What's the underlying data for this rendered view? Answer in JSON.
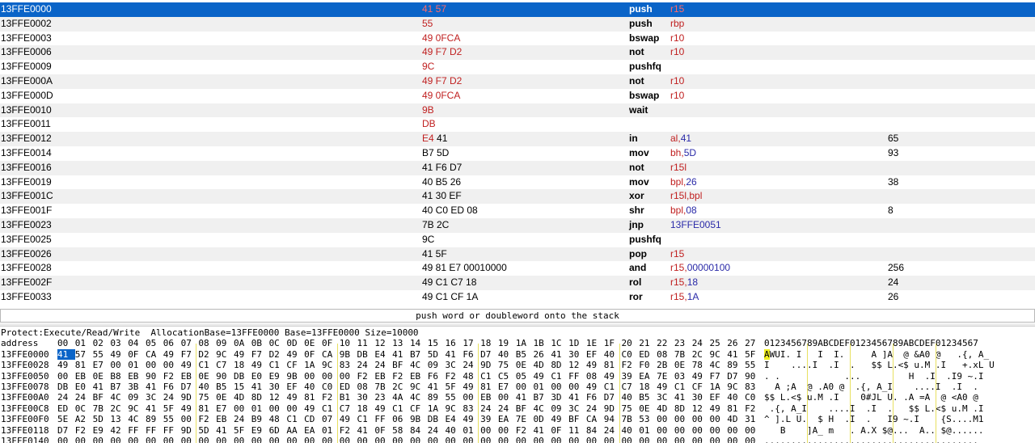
{
  "disasm": {
    "rows": [
      {
        "addr": "13FFE0000",
        "bytes": "41 57",
        "mnemonic": "push",
        "ops": [
          {
            "t": "r15",
            "k": "r"
          }
        ],
        "comment": "",
        "bytes_mod": true
      },
      {
        "addr": "13FFE0002",
        "bytes": "55",
        "mnemonic": "push",
        "ops": [
          {
            "t": "rbp",
            "k": "r"
          }
        ],
        "comment": "",
        "bytes_mod": true
      },
      {
        "addr": "13FFE0003",
        "bytes": "49 0FCA",
        "mnemonic": "bswap",
        "ops": [
          {
            "t": "r10",
            "k": "r"
          }
        ],
        "comment": "",
        "bytes_mod": true
      },
      {
        "addr": "13FFE0006",
        "bytes": "49 F7 D2",
        "mnemonic": "not",
        "ops": [
          {
            "t": "r10",
            "k": "r"
          }
        ],
        "comment": "",
        "bytes_mod": true
      },
      {
        "addr": "13FFE0009",
        "bytes": "9C",
        "mnemonic": "pushfq",
        "ops": [],
        "comment": "",
        "bytes_mod": true
      },
      {
        "addr": "13FFE000A",
        "bytes": "49 F7 D2",
        "mnemonic": "not",
        "ops": [
          {
            "t": "r10",
            "k": "r"
          }
        ],
        "comment": "",
        "bytes_mod": true
      },
      {
        "addr": "13FFE000D",
        "bytes": "49 0FCA",
        "mnemonic": "bswap",
        "ops": [
          {
            "t": "r10",
            "k": "r"
          }
        ],
        "comment": "",
        "bytes_mod": true
      },
      {
        "addr": "13FFE0010",
        "bytes": "9B",
        "mnemonic": "wait",
        "ops": [],
        "comment": "",
        "bytes_mod": true
      },
      {
        "addr": "13FFE0011",
        "bytes": "DB",
        "mnemonic": "",
        "ops": [],
        "comment": "",
        "bytes_mod": true
      },
      {
        "addr": "13FFE0012",
        "bytes": "E4 41",
        "mnemonic": "in",
        "ops": [
          {
            "t": "al",
            "k": "r"
          },
          {
            "t": ",",
            "k": "r"
          },
          {
            "t": "41",
            "k": "i"
          }
        ],
        "comment": "65",
        "bytes_mod": "partial"
      },
      {
        "addr": "13FFE0014",
        "bytes": "B7 5D",
        "mnemonic": "mov",
        "ops": [
          {
            "t": "bh",
            "k": "r"
          },
          {
            "t": ",",
            "k": "r"
          },
          {
            "t": "5D",
            "k": "i"
          }
        ],
        "comment": "93",
        "bytes_mod": false
      },
      {
        "addr": "13FFE0016",
        "bytes": "41 F6 D7",
        "mnemonic": "not",
        "ops": [
          {
            "t": "r15l",
            "k": "r"
          }
        ],
        "comment": "",
        "bytes_mod": false
      },
      {
        "addr": "13FFE0019",
        "bytes": "40 B5 26",
        "mnemonic": "mov",
        "ops": [
          {
            "t": "bpl",
            "k": "r"
          },
          {
            "t": ",",
            "k": "r"
          },
          {
            "t": "26",
            "k": "i"
          }
        ],
        "comment": "38",
        "bytes_mod": false
      },
      {
        "addr": "13FFE001C",
        "bytes": "41 30 EF",
        "mnemonic": "xor",
        "ops": [
          {
            "t": "r15l,bpl",
            "k": "r"
          }
        ],
        "comment": "",
        "bytes_mod": false
      },
      {
        "addr": "13FFE001F",
        "bytes": "40 C0 ED 08",
        "mnemonic": "shr",
        "ops": [
          {
            "t": "bpl",
            "k": "r"
          },
          {
            "t": ",",
            "k": "r"
          },
          {
            "t": "08",
            "k": "i"
          }
        ],
        "comment": "8",
        "bytes_mod": false
      },
      {
        "addr": "13FFE0023",
        "bytes": "7B 2C",
        "mnemonic": "jnp",
        "ops": [
          {
            "t": "13FFE0051",
            "k": "j"
          }
        ],
        "comment": "",
        "bytes_mod": false
      },
      {
        "addr": "13FFE0025",
        "bytes": "9C",
        "mnemonic": "pushfq",
        "ops": [],
        "comment": "",
        "bytes_mod": false
      },
      {
        "addr": "13FFE0026",
        "bytes": "41 5F",
        "mnemonic": "pop",
        "ops": [
          {
            "t": "r15",
            "k": "r"
          }
        ],
        "comment": "",
        "bytes_mod": false
      },
      {
        "addr": "13FFE0028",
        "bytes": "49 81 E7 00010000",
        "mnemonic": "and",
        "ops": [
          {
            "t": "r15",
            "k": "r"
          },
          {
            "t": ",",
            "k": "r"
          },
          {
            "t": "00000100",
            "k": "i"
          }
        ],
        "comment": "256",
        "bytes_mod": false
      },
      {
        "addr": "13FFE002F",
        "bytes": "49 C1 C7 18",
        "mnemonic": "rol",
        "ops": [
          {
            "t": "r15",
            "k": "r"
          },
          {
            "t": ",",
            "k": "r"
          },
          {
            "t": "18",
            "k": "i"
          }
        ],
        "comment": "24",
        "bytes_mod": false
      },
      {
        "addr": "13FFE0033",
        "bytes": "49 C1 CF 1A",
        "mnemonic": "ror",
        "ops": [
          {
            "t": "r15",
            "k": "r"
          },
          {
            "t": ",",
            "k": "r"
          },
          {
            "t": "1A",
            "k": "i"
          }
        ],
        "comment": "26",
        "bytes_mod": false
      }
    ]
  },
  "info_bar": {
    "text": "push word or doubleword onto the stack"
  },
  "dump": {
    "protect_line": "Protect:Execute/Read/Write  AllocationBase=13FFE0000 Base=13FFE0000 Size=10000",
    "header_addr": "address",
    "header_hex": "00 01 02 03 04 05 06 07 08 09 0A 0B 0C 0D 0E 0F 10 11 12 13 14 15 16 17 18 19 1A 1B 1C 1D 1E 1F 20 21 22 23 24 25 26 27",
    "header_ascii": "0123456789ABCDEF0123456789ABCDEF01234567",
    "rows": [
      {
        "addr": "13FFE0000",
        "hex": "41 57 55 49 0F CA 49 F7 D2 9C 49 F7 D2 49 0F CA 9B DB E4 41 B7 5D 41 F6 D7 40 B5 26 41 30 EF 40 C0 ED 08 7B 2C 9C 41 5F",
        "ascii": "AWUI. I   I  I.     A ]A  @ &A0 @   .{, A_"
      },
      {
        "addr": "13FFE0028",
        "hex": "49 81 E7 00 01 00 00 49 C1 C7 18 49 C1 CF 1A 9C 83 24 24 BF 4C 09 3C 24 9D 75 0E 4D 8D 12 49 81 F2 F0 2B 0E 78 4C 89 55",
        "ascii": "I    ....I  .I  .   $$ L.<$ u.M .I   +.xL U"
      },
      {
        "addr": "13FFE0050",
        "hex": "00 EB 0E B8 EB 90 F2 EB 0E 90 DB E0 E9 9B 00 00 00 F2 EB F2 EB F6 F2 48 C1 C5 05 49 C1 FF 08 49 39 EA 7E 03 49 F7 D7 90",
        "ascii": ". .            ...         H  .I  .I9 ~.I"
      },
      {
        "addr": "13FFE0078",
        "hex": "DB E0 41 B7 3B 41 F6 D7 40 B5 15 41 30 EF 40 C0 ED 08 7B 2C 9C 41 5F 49 81 E7 00 01 00 00 49 C1 C7 18 49 C1 CF 1A 9C 83",
        "ascii": "  A ;A  @ .A0 @  .{, A_I    ....I  .I  ."
      },
      {
        "addr": "13FFE00A0",
        "hex": "24 24 BF 4C 09 3C 24 9D 75 0E 4D 8D 12 49 81 F2 B1 30 23 4A 4C 89 55 00 EB 00 41 B7 3D 41 F6 D7 40 B5 3C 41 30 EF 40 C0",
        "ascii": "$$ L.<$ u.M .I    0#JL U. .A =A  @ <A0 @"
      },
      {
        "addr": "13FFE00C8",
        "hex": "ED 0C 7B 2C 9C 41 5F 49 81 E7 00 01 00 00 49 C1 C7 18 49 C1 CF 1A 9C 83 24 24 BF 4C 09 3C 24 9D 75 0E 4D 8D 12 49 81 F2",
        "ascii": " .{, A_I    ....I  .I  .   $$ L.<$ u.M .I"
      },
      {
        "addr": "13FFE00F0",
        "hex": "5E A2 5D 13 4C 89 55 00 F2 EB 24 B9 48 C1 CD 07 49 C1 FF 06 9B DB E4 49 39 EA 7E 0D 49 BF CA 94 7B 53 00 00 00 00 4D 31",
        "ascii": "^ ].L U.  $ H  .I  .   I9 ~.I    {S....M1"
      },
      {
        "addr": "13FFE0118",
        "hex": "D7 F2 E9 42 FF FF FF 9D 5D 41 5F E9 6D AA EA 01 F2 41 0F 58 84 24 40 01 00 00 F2 41 0F 11 84 24 40 01 00 00 00 00 00 00",
        "ascii": "   B    ]A_ m   . A.X $@...  A.. $@......"
      },
      {
        "addr": "13FFE0140",
        "hex": "00 00 00 00 00 00 00 00 00 00 00 00 00 00 00 00 00 00 00 00 00 00 00 00 00 00 00 00 00 00 00 00 00 00 00 00 00 00 00 00",
        "ascii": "........................................"
      }
    ]
  },
  "colors": {
    "selection": "#0a64c8",
    "modified_bytes": "#c02020",
    "immediate": "#2a2aa8",
    "ascii_highlight": "#f0f020"
  }
}
